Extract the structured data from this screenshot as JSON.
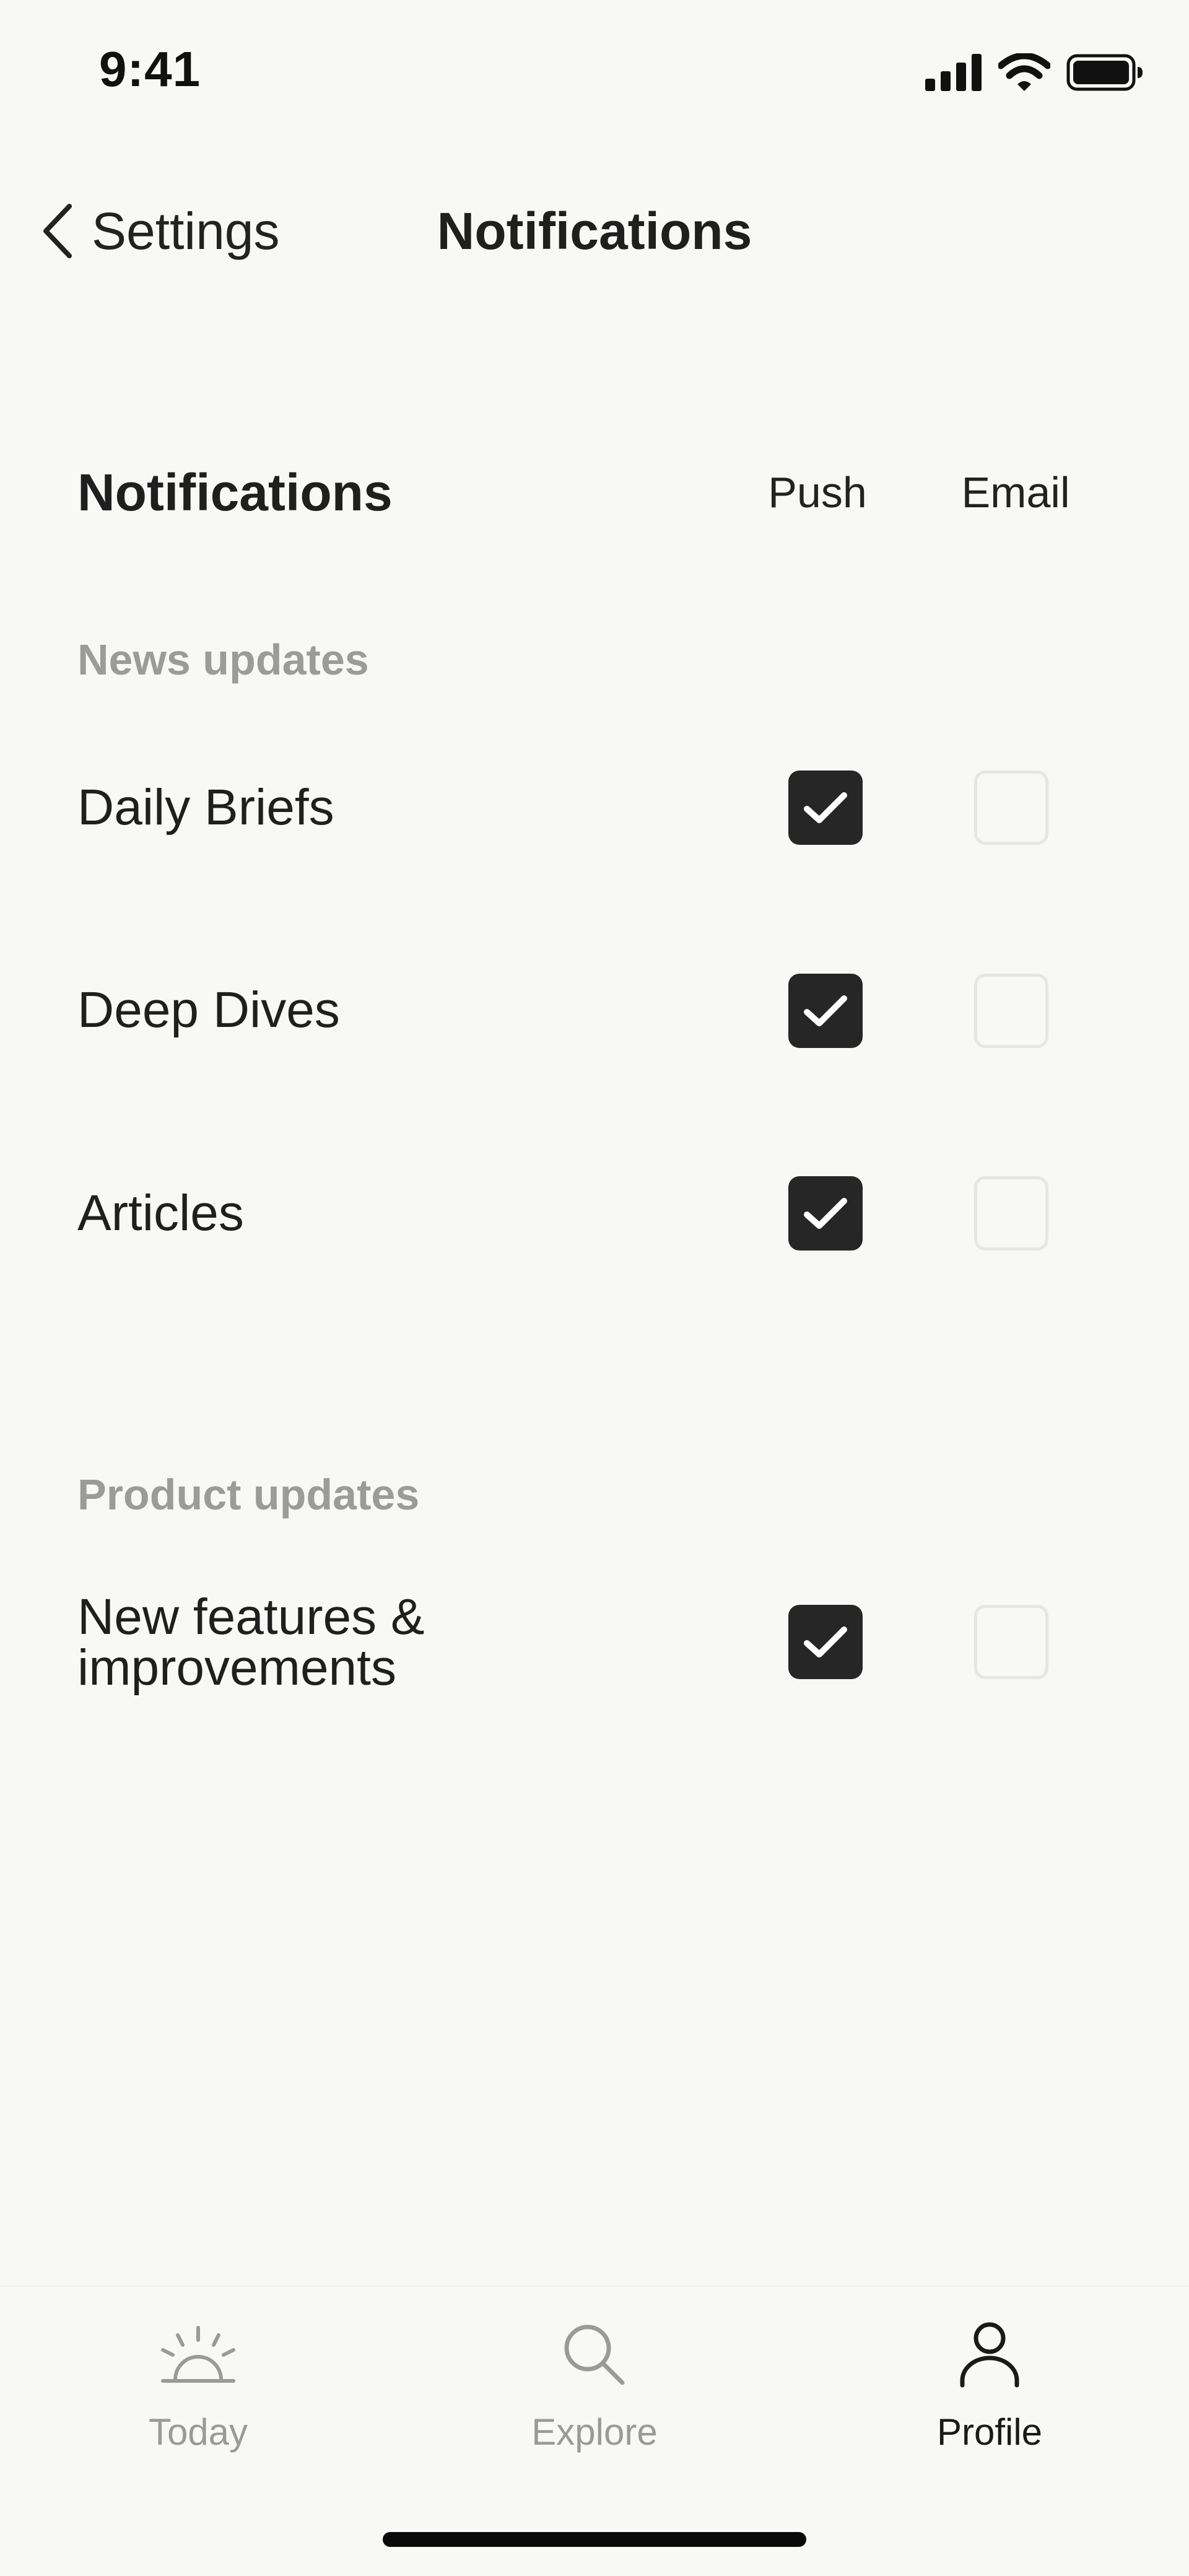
{
  "status_bar": {
    "time": "9:41"
  },
  "nav": {
    "back_label": "Settings",
    "title": "Notifications"
  },
  "table": {
    "heading": "Notifications",
    "columns": [
      "Push",
      "Email"
    ]
  },
  "groups": [
    {
      "label": "News updates",
      "items": [
        {
          "label": "Daily Briefs",
          "push": true,
          "email": false
        },
        {
          "label": "Deep Dives",
          "push": true,
          "email": false
        },
        {
          "label": "Articles",
          "push": true,
          "email": false
        }
      ]
    },
    {
      "label": "Product updates",
      "items": [
        {
          "label_line1": "New features &",
          "label_line2": "improvements",
          "push": true,
          "email": false
        }
      ]
    }
  ],
  "tabs": [
    {
      "label": "Today",
      "icon": "sunrise-icon",
      "active": false
    },
    {
      "label": "Explore",
      "icon": "search-icon",
      "active": false
    },
    {
      "label": "Profile",
      "icon": "person-icon",
      "active": true
    }
  ],
  "colors": {
    "background": "#f8f8f6",
    "checked": "#262626",
    "unchecked_border": "#e6e6e3",
    "muted_text": "#9b9b99"
  }
}
